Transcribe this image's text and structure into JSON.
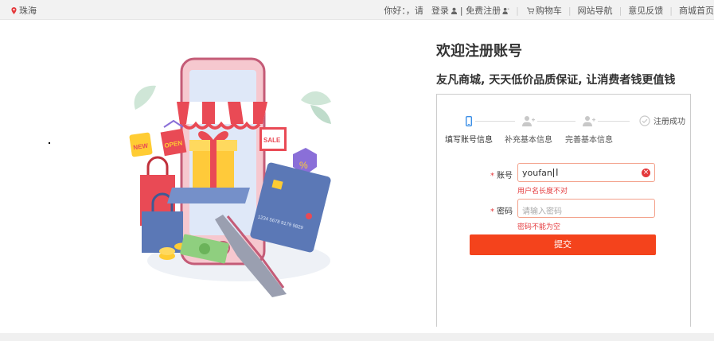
{
  "topbar": {
    "location": "珠海",
    "greeting": "你好：，请",
    "login": "登录",
    "register": "| 免费注册",
    "cart": "购物车",
    "site_nav": "网站导航",
    "feedback": "意见反馈",
    "home": "商城首页"
  },
  "main": {
    "title": "欢迎注册账号",
    "subtitle": "友凡商城, 天天低价品质保证, 让消费者钱更值钱"
  },
  "illustration": {
    "sign_new": "NEW",
    "sign_open": "OPEN",
    "sign_sale": "SALE",
    "percent": "%",
    "card_number": "1234 5678 9179 9829"
  },
  "steps": [
    {
      "label": "填写账号信息",
      "icon": "phone-icon",
      "active": true
    },
    {
      "label": "补充基本信息",
      "icon": "user-plus-icon",
      "active": false
    },
    {
      "label": "完善基本信息",
      "icon": "user-plus-icon",
      "active": false
    },
    {
      "label": "注册成功",
      "icon": "check-circle-icon",
      "active": false
    }
  ],
  "form": {
    "account": {
      "label": "账号",
      "value": "youfan",
      "error": "用户名长度不对"
    },
    "password": {
      "label": "密码",
      "placeholder": "请输入密码",
      "error": "密码不能为空"
    },
    "required_mark": "*",
    "submit": "提交"
  },
  "colors": {
    "accent": "#f4431c",
    "error": "#e4393c",
    "input_border": "#f3a08a",
    "step_active": "#3a8ee6"
  }
}
